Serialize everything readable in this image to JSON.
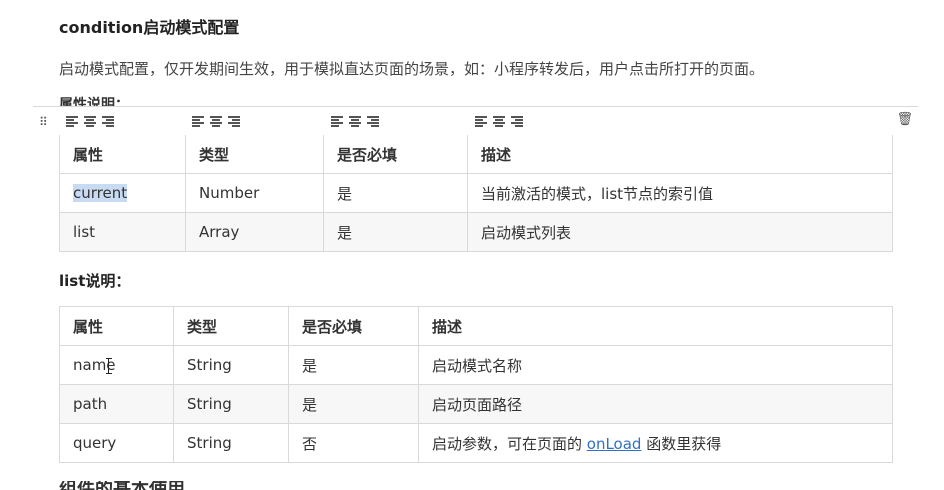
{
  "doc": {
    "heading": "condition启动模式配置",
    "description": "启动模式配置，仅开发期间生效，用于模拟直达页面的场景，如：小程序转发后，用户点击所打开的页面。",
    "attr_note": "属性说明：",
    "list_heading": "list说明：",
    "bottom_heading": "组件的基本使用"
  },
  "table1": {
    "headers": [
      "属性",
      "类型",
      "是否必填",
      "描述"
    ],
    "rows": [
      [
        "current",
        "Number",
        "是",
        "当前激活的模式，list节点的索引值"
      ],
      [
        "list",
        "Array",
        "是",
        "启动模式列表"
      ]
    ]
  },
  "table2": {
    "headers": [
      "属性",
      "类型",
      "是否必填",
      "描述"
    ],
    "rows": [
      [
        "name",
        "String",
        "是",
        "启动模式名称"
      ],
      [
        "path",
        "String",
        "是",
        "启动页面路径"
      ],
      [
        "query",
        "String",
        "否",
        "启动参数，可在页面的 ",
        "onLoad",
        " 函数里获得"
      ]
    ]
  },
  "toolbar": {
    "grid_icon": "⠿",
    "trash_icon": "🗑"
  },
  "colors": {
    "selection_highlight": "#c8dbf2",
    "link": "#2f71c6",
    "row_alt": "#f7f7f7"
  }
}
